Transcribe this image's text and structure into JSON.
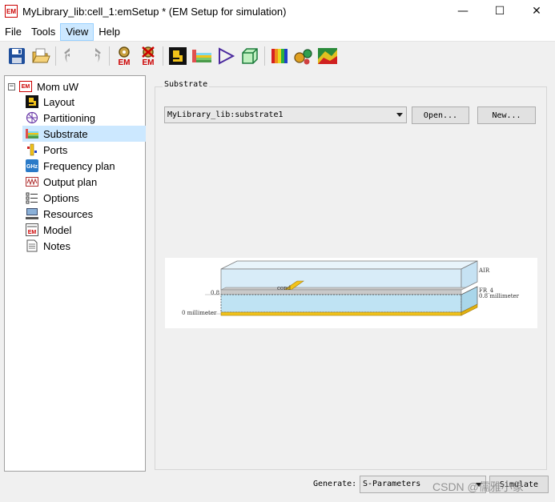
{
  "window": {
    "title": "MyLibrary_lib:cell_1:emSetup * (EM Setup for simulation)",
    "app_icon_text": "EM",
    "minimize_glyph": "—",
    "maximize_glyph": "☐",
    "close_glyph": "✕"
  },
  "menu": [
    {
      "label": "File"
    },
    {
      "label": "Tools"
    },
    {
      "label": "View"
    },
    {
      "label": "Help"
    }
  ],
  "toolbar": {
    "em_label_1": "EM",
    "em_label_2": "EM",
    "icons": [
      "save-icon",
      "open-folder-icon",
      "undo-icon",
      "redo-icon",
      "em-setup-icon",
      "em-remove-icon",
      "layout-icon",
      "substrate-icon",
      "port-icon",
      "3d-box-icon",
      "rainbow-icon",
      "gear-cluster-icon",
      "field-plot-icon"
    ]
  },
  "tree": {
    "root_label": "Mom uW",
    "root_icon_text": "EM",
    "collapse_glyph": "−",
    "items": [
      {
        "label": "Layout",
        "icon": "layout-icon"
      },
      {
        "label": "Partitioning",
        "icon": "partitioning-icon"
      },
      {
        "label": "Substrate",
        "icon": "substrate-icon",
        "selected": true
      },
      {
        "label": "Ports",
        "icon": "ports-icon"
      },
      {
        "label": "Frequency plan",
        "icon": "frequency-icon"
      },
      {
        "label": "Output plan",
        "icon": "output-plan-icon"
      },
      {
        "label": "Options",
        "icon": "options-icon"
      },
      {
        "label": "Resources",
        "icon": "resources-icon"
      },
      {
        "label": "Model",
        "icon": "model-icon"
      },
      {
        "label": "Notes",
        "icon": "notes-icon"
      }
    ],
    "freq_icon_text": "GHz",
    "model_icon_text": "EM"
  },
  "substrate": {
    "group_title": "Substrate",
    "selected": "MyLibrary_lib:substrate1",
    "open_button": "Open...",
    "new_button": "New...",
    "diagram": {
      "air_label": "AIR",
      "fr4_label": "FR_4",
      "cond_label": "cond",
      "thickness_label": "0.8 millimeter",
      "top_level_label": "0.8",
      "bottom_level_label": "0 millimeter"
    }
  },
  "footer": {
    "generate_label": "Generate:",
    "generate_value": "S-Parameters",
    "simulate_button": "Simulate",
    "watermark": "CSDN @儒雅小象"
  },
  "colors": {
    "selection": "#cce8ff",
    "air_layer": "#d8ecf8",
    "substrate_layer": "#bfe3f3",
    "conductor": "#f2c31a",
    "em_red": "#cc0000"
  }
}
